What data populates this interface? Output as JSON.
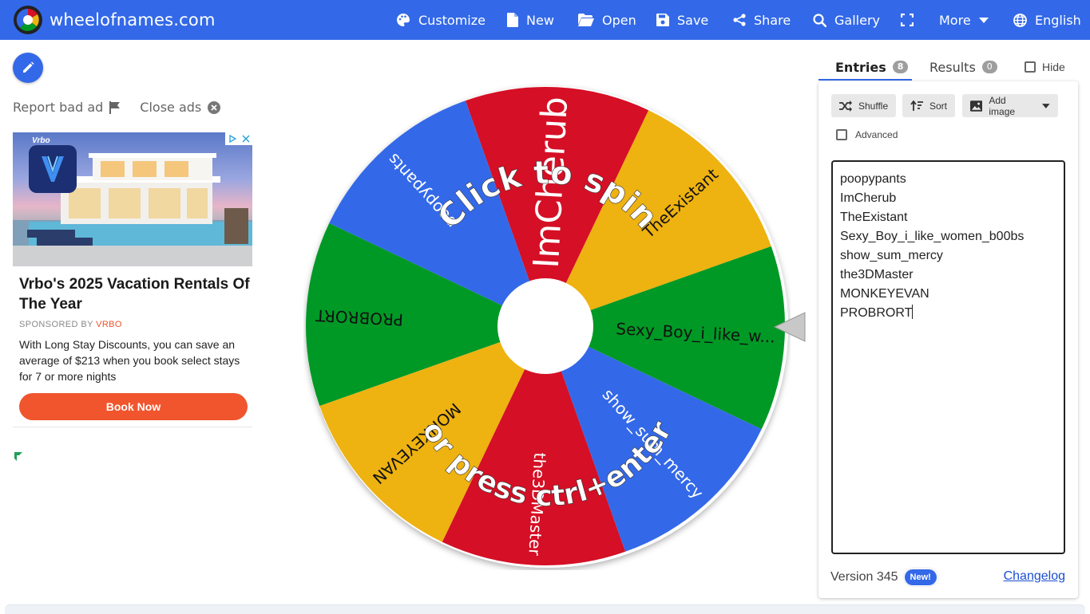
{
  "header": {
    "brand": "wheelofnames.com",
    "nav": [
      {
        "label": "Customize",
        "icon": "palette-icon"
      },
      {
        "label": "New",
        "icon": "file-icon"
      },
      {
        "label": "Open",
        "icon": "folder-open-icon"
      },
      {
        "label": "Save",
        "icon": "floppy-icon"
      },
      {
        "label": "Share",
        "icon": "share-icon"
      },
      {
        "label": "Gallery",
        "icon": "search-icon"
      },
      {
        "label": "",
        "icon": "fullscreen-icon"
      },
      {
        "label": "More",
        "icon": "chevron-down-icon"
      },
      {
        "label": "English",
        "icon": "globe-icon"
      }
    ]
  },
  "ads": {
    "report_label": "Report bad ad",
    "close_label": "Close ads",
    "brand_mark": "Vrbo",
    "title": "Vrbo's 2025 Vacation Rentals Of The Year",
    "sponsored_by": "SPONSORED BY",
    "sponsor": "VRBO",
    "body": "With Long Stay Discounts, you can save an average of $213 when you book select stays for 7 or more nights",
    "cta": "Book Now"
  },
  "wheel": {
    "prompt_top": "Click to spin",
    "prompt_bottom": "or press ctrl+enter",
    "segments": [
      {
        "label": "TheExistant",
        "color": "#eeb211"
      },
      {
        "label": "ImCherub",
        "color": "#d50f25"
      },
      {
        "label": "poopypants",
        "color": "#3369e8"
      },
      {
        "label": "PROBRORT",
        "color": "#009925"
      },
      {
        "label": "MONKEYEVAN",
        "color": "#eeb211"
      },
      {
        "label": "the3DMaster",
        "color": "#d50f25"
      },
      {
        "label": "show_sum_mercy",
        "color": "#3369e8"
      },
      {
        "label": "Sexy_Boy_i_like_w...",
        "color": "#009925"
      }
    ]
  },
  "panel": {
    "tabs": [
      {
        "label": "Entries",
        "count": "8"
      },
      {
        "label": "Results",
        "count": "0"
      }
    ],
    "hide_label": "Hide",
    "tools": {
      "shuffle": "Shuffle",
      "sort": "Sort",
      "add_image": "Add image"
    },
    "advanced_label": "Advanced",
    "entries": [
      "poopypants",
      "ImCherub",
      "TheExistant",
      "Sexy_Boy_i_like_women_b00bs",
      "show_sum_mercy",
      "the3DMaster",
      "MONKEYEVAN",
      "PROBRORT"
    ],
    "version": "Version 345",
    "new_badge": "New!",
    "changelog": "Changelog"
  },
  "colors": {
    "primary": "#3369e8",
    "yellow": "#eeb211",
    "red": "#d50f25",
    "green": "#009925",
    "ad_cta": "#f0552d"
  }
}
